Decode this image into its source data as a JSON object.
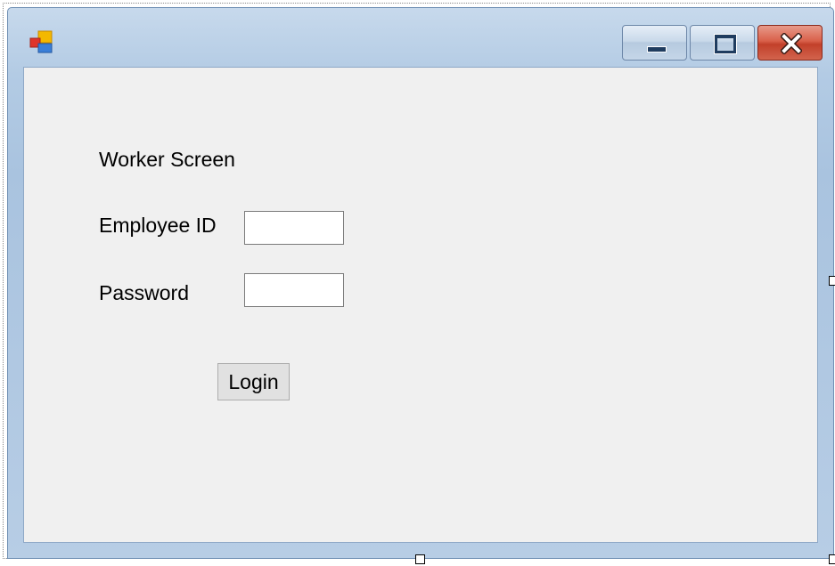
{
  "window": {
    "title": "",
    "icon": "windows-forms-app-icon",
    "caption_buttons": [
      {
        "name": "minimize",
        "icon": "minimize-icon"
      },
      {
        "name": "maximize",
        "icon": "maximize-icon"
      },
      {
        "name": "close",
        "icon": "close-icon"
      }
    ]
  },
  "form": {
    "heading": "Worker Screen",
    "employee_id_label": "Employee ID",
    "employee_id_value": "",
    "password_label": "Password",
    "password_value": "",
    "login_label": "Login"
  },
  "colors": {
    "client_background": "#f0f0f0",
    "frame": "#b3cbe4",
    "close_button": "#c94b35",
    "button_face": "#e1e1e1"
  }
}
